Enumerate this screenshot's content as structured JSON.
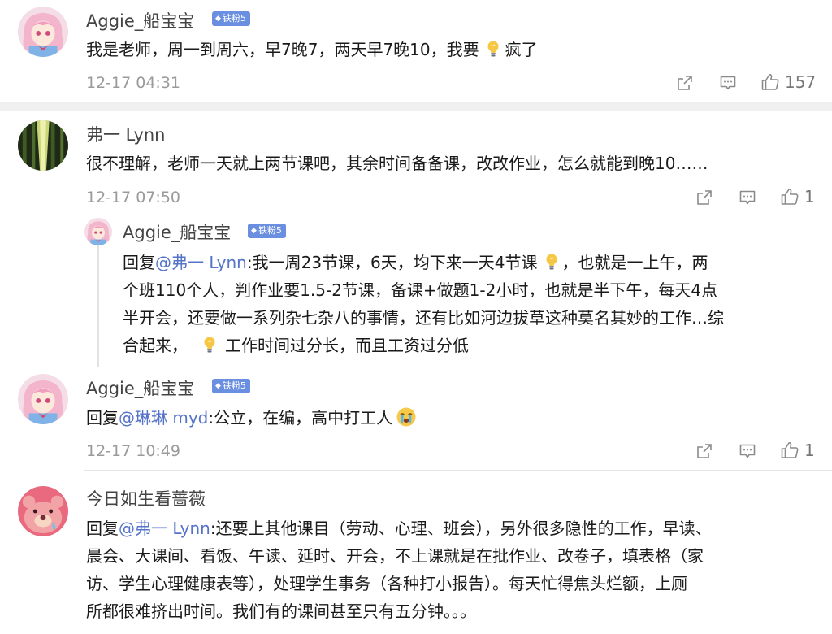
{
  "comments": [
    {
      "username": "Aggie_船宝宝",
      "badge": "铁粉5",
      "text_before": "我是老师，周一到周六，早7晚7，两天早7晚10，我要",
      "text_after": "疯了",
      "time": "12-17 04:31",
      "likes": "157"
    },
    {
      "username": "弗一 Lynn",
      "text": "很不理解，老师一天就上两节课吧，其余时间备备课，改改作业，怎么就能到晚10……",
      "time": "12-17 07:50",
      "likes": "1",
      "reply": {
        "username": "Aggie_船宝宝",
        "badge": "铁粉5",
        "prefix": "回复",
        "mention": "@弗一 Lynn",
        "line1_a": ":我一周23节课，6天，均下来一天4节课",
        "line1_b": "，也就是一上午，两",
        "line2": "个班110个人，判作业要1.5-2节课，备课+做题1-2小时，也就是半下午，每天4点",
        "line3": "半开会，还要做一系列杂七杂八的事情，还有比如河边拔草这种莫名其妙的工作…综",
        "line4_a": "合起来，",
        "line4_b": "工作时间过分长，而且工资过分低"
      }
    },
    {
      "username": "Aggie_船宝宝",
      "badge": "铁粉5",
      "prefix": "回复",
      "mention": "@琳琳 myd",
      "text": ":公立，在编，高中打工人",
      "time": "12-17 10:49",
      "likes": "1"
    },
    {
      "username": "今日如生看蔷薇",
      "prefix": "回复",
      "mention": "@弗一 Lynn",
      "line1": ":还要上其他课目（劳动、心理、班会），另外很多隐性的工作，早读、",
      "line2": "晨会、大课间、看饭、午读、延时、开会，不上课就是在批作业、改卷子，填表格（家",
      "line3": "访、学生心理健康表等），处理学生事务（各种打小报告）。每天忙得焦头烂额，上厕",
      "line4": "所都很难挤出时间。我们有的课间甚至只有五分钟。。。"
    }
  ],
  "icons": {
    "share": "share-icon",
    "comment": "comment-icon",
    "like": "thumbs-up-icon",
    "bulb": "lightbulb-emoji",
    "crying": "crying-emoji"
  },
  "colors": {
    "mention": "#5573c8",
    "badge": "#6a8fe0",
    "time": "#9a9a9a"
  }
}
